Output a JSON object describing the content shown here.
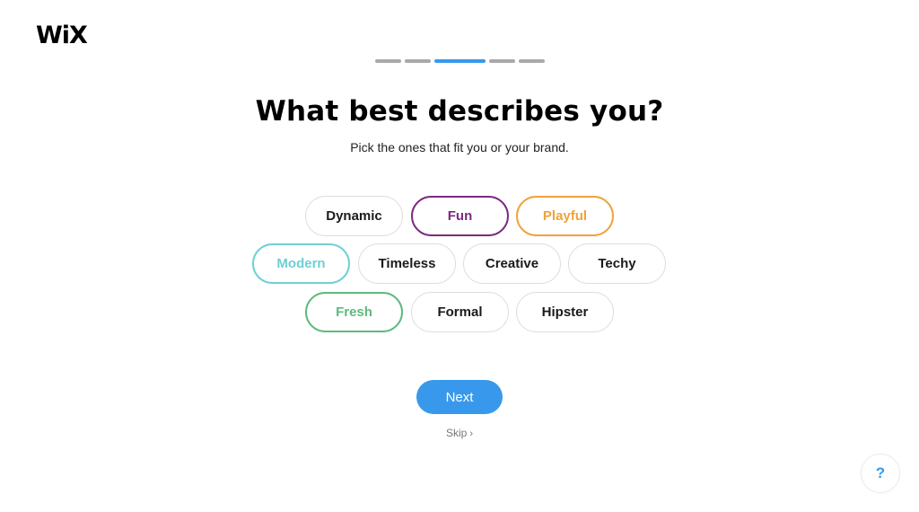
{
  "brand": {
    "logo_text": "WiX"
  },
  "progress": {
    "total_steps": 5,
    "current_step": 3
  },
  "header": {
    "title": "What best describes you?",
    "subtitle": "Pick the ones that fit you or your brand."
  },
  "options": [
    {
      "label": "Dynamic",
      "selected": false,
      "color": "#1a1a1a"
    },
    {
      "label": "Fun",
      "selected": true,
      "color": "#7b2a7e"
    },
    {
      "label": "Playful",
      "selected": true,
      "color": "#f0a23c"
    },
    {
      "label": "Modern",
      "selected": true,
      "color": "#6fcfd4"
    },
    {
      "label": "Timeless",
      "selected": false,
      "color": "#1a1a1a"
    },
    {
      "label": "Creative",
      "selected": false,
      "color": "#1a1a1a"
    },
    {
      "label": "Techy",
      "selected": false,
      "color": "#1a1a1a"
    },
    {
      "label": "Fresh",
      "selected": true,
      "color": "#5dba7c"
    },
    {
      "label": "Formal",
      "selected": false,
      "color": "#1a1a1a"
    },
    {
      "label": "Hipster",
      "selected": false,
      "color": "#1a1a1a"
    }
  ],
  "actions": {
    "next_label": "Next",
    "skip_label": "Skip",
    "skip_icon": "chevron-right-icon",
    "skip_glyph": "›",
    "help_glyph": "?",
    "accent": "#3899ec"
  }
}
